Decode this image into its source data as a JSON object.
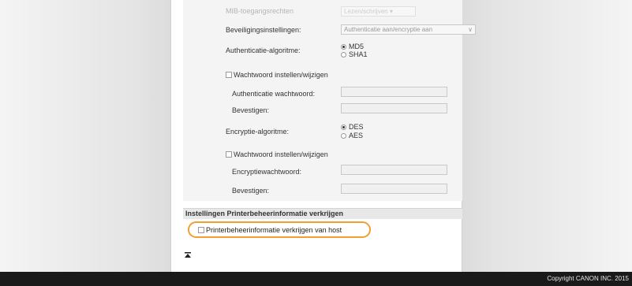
{
  "form": {
    "faded_label": "MIB-toegangsrechten",
    "faded_select": "Lezen/schrijven",
    "security_label": "Beveiligingsinstellingen:",
    "security_select": "Authenticatie aan/encryptie aan",
    "auth_algo_label": "Authenticatie-algoritme:",
    "auth_options": [
      "MD5",
      "SHA1"
    ],
    "auth_selected": "MD5",
    "set_password_label": "Wachtwoord instellen/wijzigen",
    "auth_password_label": "Authenticatie wachtwoord:",
    "confirm_label": "Bevestigen:",
    "enc_algo_label": "Encryptie-algoritme:",
    "enc_options": [
      "DES",
      "AES"
    ],
    "enc_selected": "DES",
    "set_password_label_2": "Wachtwoord instellen/wijzigen",
    "enc_password_label": "Encryptiewachtwoord:",
    "confirm_label_2": "Bevestigen:"
  },
  "section": {
    "title": "Instellingen Printerbeheerinformatie verkrijgen",
    "checkbox_label": "Printerbeheerinformatie verkrijgen van host",
    "checkbox_checked": false
  },
  "nav": {
    "top_icon": "go-to-top-icon"
  },
  "footer": {
    "copyright": "Copyright CANON INC. 2015"
  },
  "colors": {
    "highlight": "#f0a030",
    "footer_bg": "#1a1a1a"
  }
}
